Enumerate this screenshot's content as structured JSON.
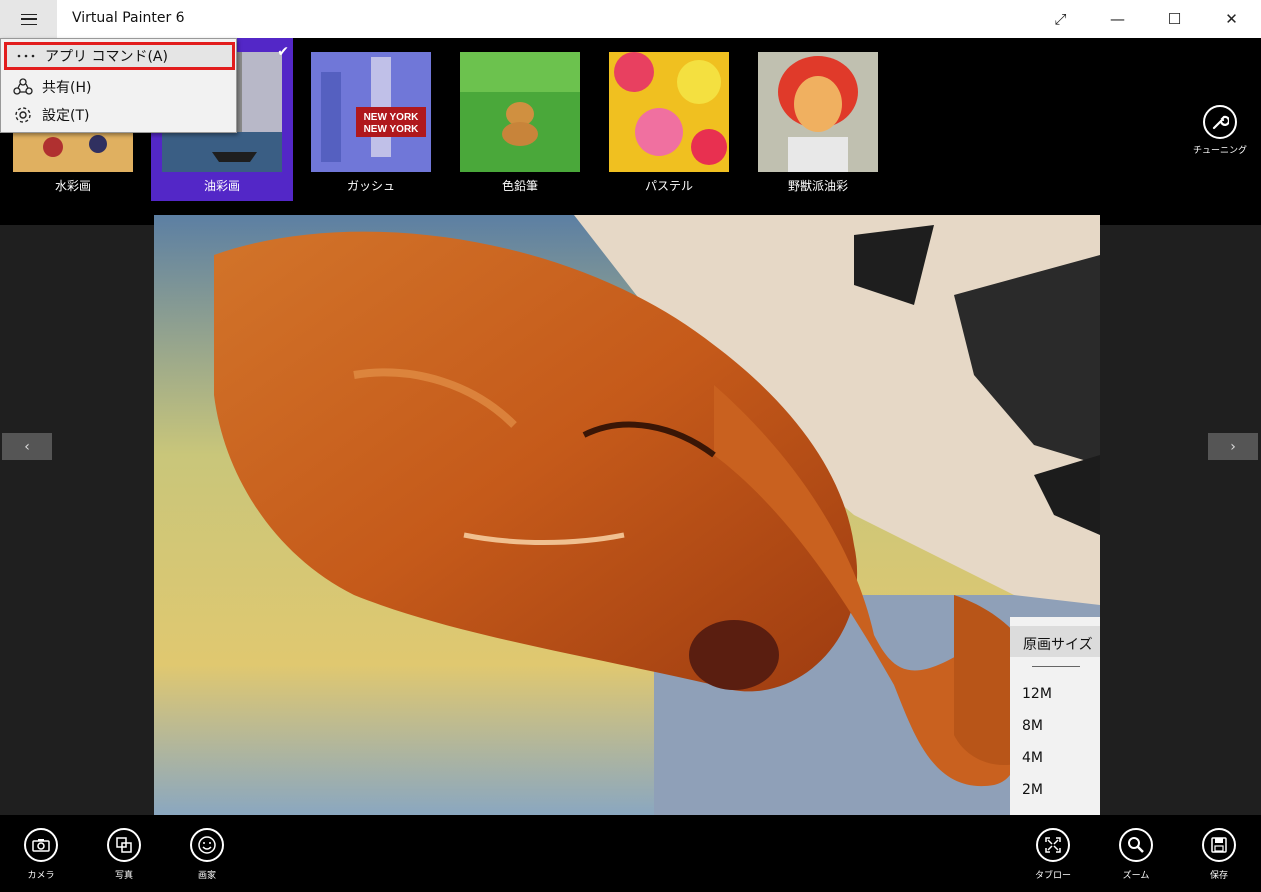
{
  "titlebar": {
    "app_title": "Virtual Painter 6",
    "restore_glyph": "⤢",
    "minimize_glyph": "—",
    "maximize_glyph": "☐",
    "close_glyph": "✕"
  },
  "app_menu": {
    "items": [
      {
        "label": "アプリ コマンド(A)",
        "icon": "more-icon"
      },
      {
        "label": "共有(H)",
        "icon": "share-icon"
      },
      {
        "label": "設定(T)",
        "icon": "gear-icon"
      }
    ]
  },
  "styles": {
    "items": [
      {
        "label": "水彩画",
        "selected": false
      },
      {
        "label": "油彩画",
        "selected": true
      },
      {
        "label": "ガッシュ",
        "selected": false
      },
      {
        "label": "色鉛筆",
        "selected": false
      },
      {
        "label": "パステル",
        "selected": false
      },
      {
        "label": "野獣派油彩",
        "selected": false
      }
    ],
    "check_glyph": "✔",
    "ny_sign_1": "NEW YORK",
    "ny_sign_2": "NEW YORK"
  },
  "tuning": {
    "label": "チューニング"
  },
  "nav": {
    "prev": "‹",
    "next": "›"
  },
  "size_menu": {
    "items": [
      "原画サイズ",
      "12M",
      "8M",
      "4M",
      "2M"
    ]
  },
  "bottombar": {
    "left": [
      {
        "label": "カメラ",
        "icon": "camera-icon"
      },
      {
        "label": "写真",
        "icon": "photo-icon"
      },
      {
        "label": "画家",
        "icon": "smiley-icon"
      }
    ],
    "right": [
      {
        "label": "タブロー",
        "icon": "tableau-icon"
      },
      {
        "label": "ズーム",
        "icon": "zoom-icon"
      },
      {
        "label": "保存",
        "icon": "save-icon"
      }
    ]
  },
  "colors": {
    "accent": "#5327c7",
    "highlight_border": "#e21d1d"
  }
}
